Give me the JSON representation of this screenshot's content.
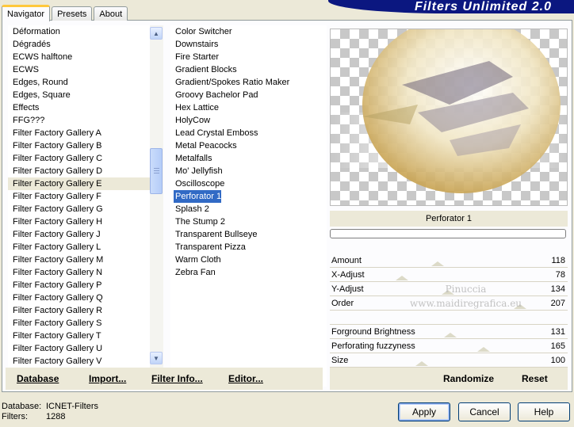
{
  "tabs": [
    "Navigator",
    "Presets",
    "About"
  ],
  "app_title": "Filters Unlimited 2.0",
  "categories": [
    "Déformation",
    "Dégradés",
    "ECWS halftone",
    "ECWS",
    "Edges, Round",
    "Edges, Square",
    "Effects",
    "FFG???",
    "Filter Factory Gallery A",
    "Filter Factory Gallery B",
    "Filter Factory Gallery C",
    "Filter Factory Gallery D",
    "Filter Factory Gallery E",
    "Filter Factory Gallery F",
    "Filter Factory Gallery G",
    "Filter Factory Gallery H",
    "Filter Factory Gallery J",
    "Filter Factory Gallery L",
    "Filter Factory Gallery M",
    "Filter Factory Gallery N",
    "Filter Factory Gallery P",
    "Filter Factory Gallery Q",
    "Filter Factory Gallery R",
    "Filter Factory Gallery S",
    "Filter Factory Gallery T",
    "Filter Factory Gallery U",
    "Filter Factory Gallery V"
  ],
  "selected_category": "Filter Factory Gallery E",
  "filters": [
    "Color Switcher",
    "Downstairs",
    "Fire Starter",
    "Gradient Blocks",
    "Gradient/Spokes Ratio Maker",
    "Groovy Bachelor Pad",
    "Hex Lattice",
    "HolyCow",
    "Lead Crystal Emboss",
    "Metal Peacocks",
    "Metalfalls",
    "Mo' Jellyfish",
    "Oscilloscope",
    "Perforator 1",
    "Splash 2",
    "The Stump 2",
    "Transparent Bullseye",
    "Transparent Pizza",
    "Warm Cloth",
    "Zebra Fan"
  ],
  "selected_filter": "Perforator 1",
  "preview_filter_name": "Perforator 1",
  "params": [
    {
      "name": "Amount",
      "value": "118"
    },
    {
      "name": "X-Adjust",
      "value": "78"
    },
    {
      "name": "Y-Adjust",
      "value": "134"
    },
    {
      "name": "Order",
      "value": "207"
    },
    {
      "name": "",
      "value": ""
    },
    {
      "name": "Forground Brightness",
      "value": "131"
    },
    {
      "name": "Perforating fuzzyness",
      "value": "165"
    },
    {
      "name": "Size",
      "value": "100"
    }
  ],
  "toolbar": {
    "database": "Database",
    "import": "Import...",
    "filter_info": "Filter Info...",
    "editor": "Editor...",
    "randomize": "Randomize",
    "reset": "Reset"
  },
  "info": {
    "database_label": "Database:",
    "database_value": "ICNET-Filters",
    "filters_label": "Filters:",
    "filters_value": "1288"
  },
  "buttons": {
    "apply": "Apply",
    "cancel": "Cancel",
    "help": "Help"
  },
  "watermark": {
    "line1": "Pinuccia",
    "line2": "www.maidiregrafica.eu"
  },
  "colors": {
    "selection": "#316ac5",
    "banner": "#0b1780",
    "dialog_bg": "#ece9d8"
  }
}
